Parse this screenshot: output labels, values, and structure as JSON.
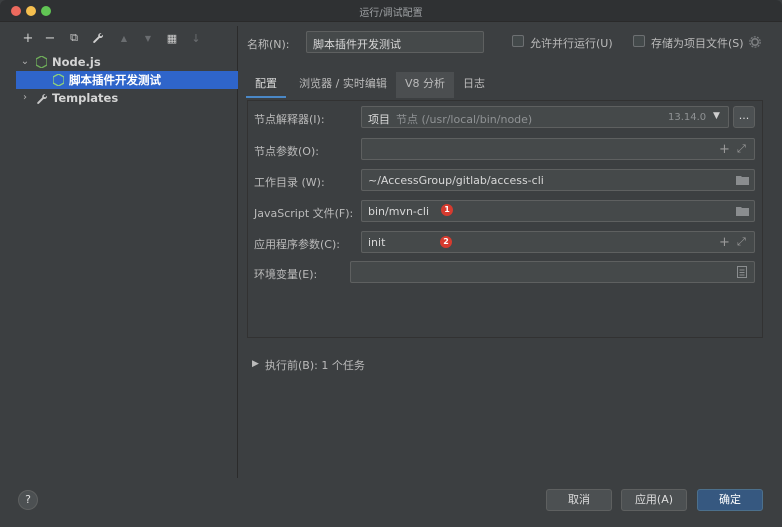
{
  "window": {
    "title": "运行/调试配置"
  },
  "toolbar": {
    "add": "+",
    "remove": "−",
    "copy": "⧉",
    "wrench": "🔧",
    "up": "▲",
    "down": "▼",
    "folder": "▦",
    "sort": "↓"
  },
  "tree": {
    "group": "Node.js",
    "selected_item": "脚本插件开发测试",
    "templates": "Templates"
  },
  "header": {
    "name_label": "名称(N):",
    "name_value": "脚本插件开发测试",
    "parallel_label": "允许并行运行(U)",
    "store_label": "存储为项目文件(S)"
  },
  "tabs": [
    "配置",
    "浏览器 / 实时编辑",
    "V8 分析",
    "日志"
  ],
  "form": {
    "interpreter_label": "节点解释器(I):",
    "interpreter_prefix": "项目",
    "interpreter_value": "节点 (/usr/local/bin/node)",
    "interpreter_version": "13.14.0",
    "ellipsis": "...",
    "node_params_label": "节点参数(O):",
    "workdir_label": "工作目录 (W):",
    "workdir_value": "~/AccessGroup/gitlab/access-cli",
    "jsfile_label": "JavaScript 文件(F):",
    "jsfile_value": "bin/mvn-cli",
    "app_params_label": "应用程序参数(C):",
    "app_params_value": "init",
    "env_label": "环境变量(E):",
    "badge1": "1",
    "badge2": "2"
  },
  "before_launch": {
    "label": "执行前(B): 1 个任务"
  },
  "footer": {
    "help": "?",
    "cancel": "取消",
    "apply": "应用(A)",
    "ok": "确定"
  },
  "colors": {
    "selection": "#2f65ca",
    "primary_button": "#365880",
    "badge": "#d63b2f",
    "tab_underline": "#4a88c7"
  }
}
